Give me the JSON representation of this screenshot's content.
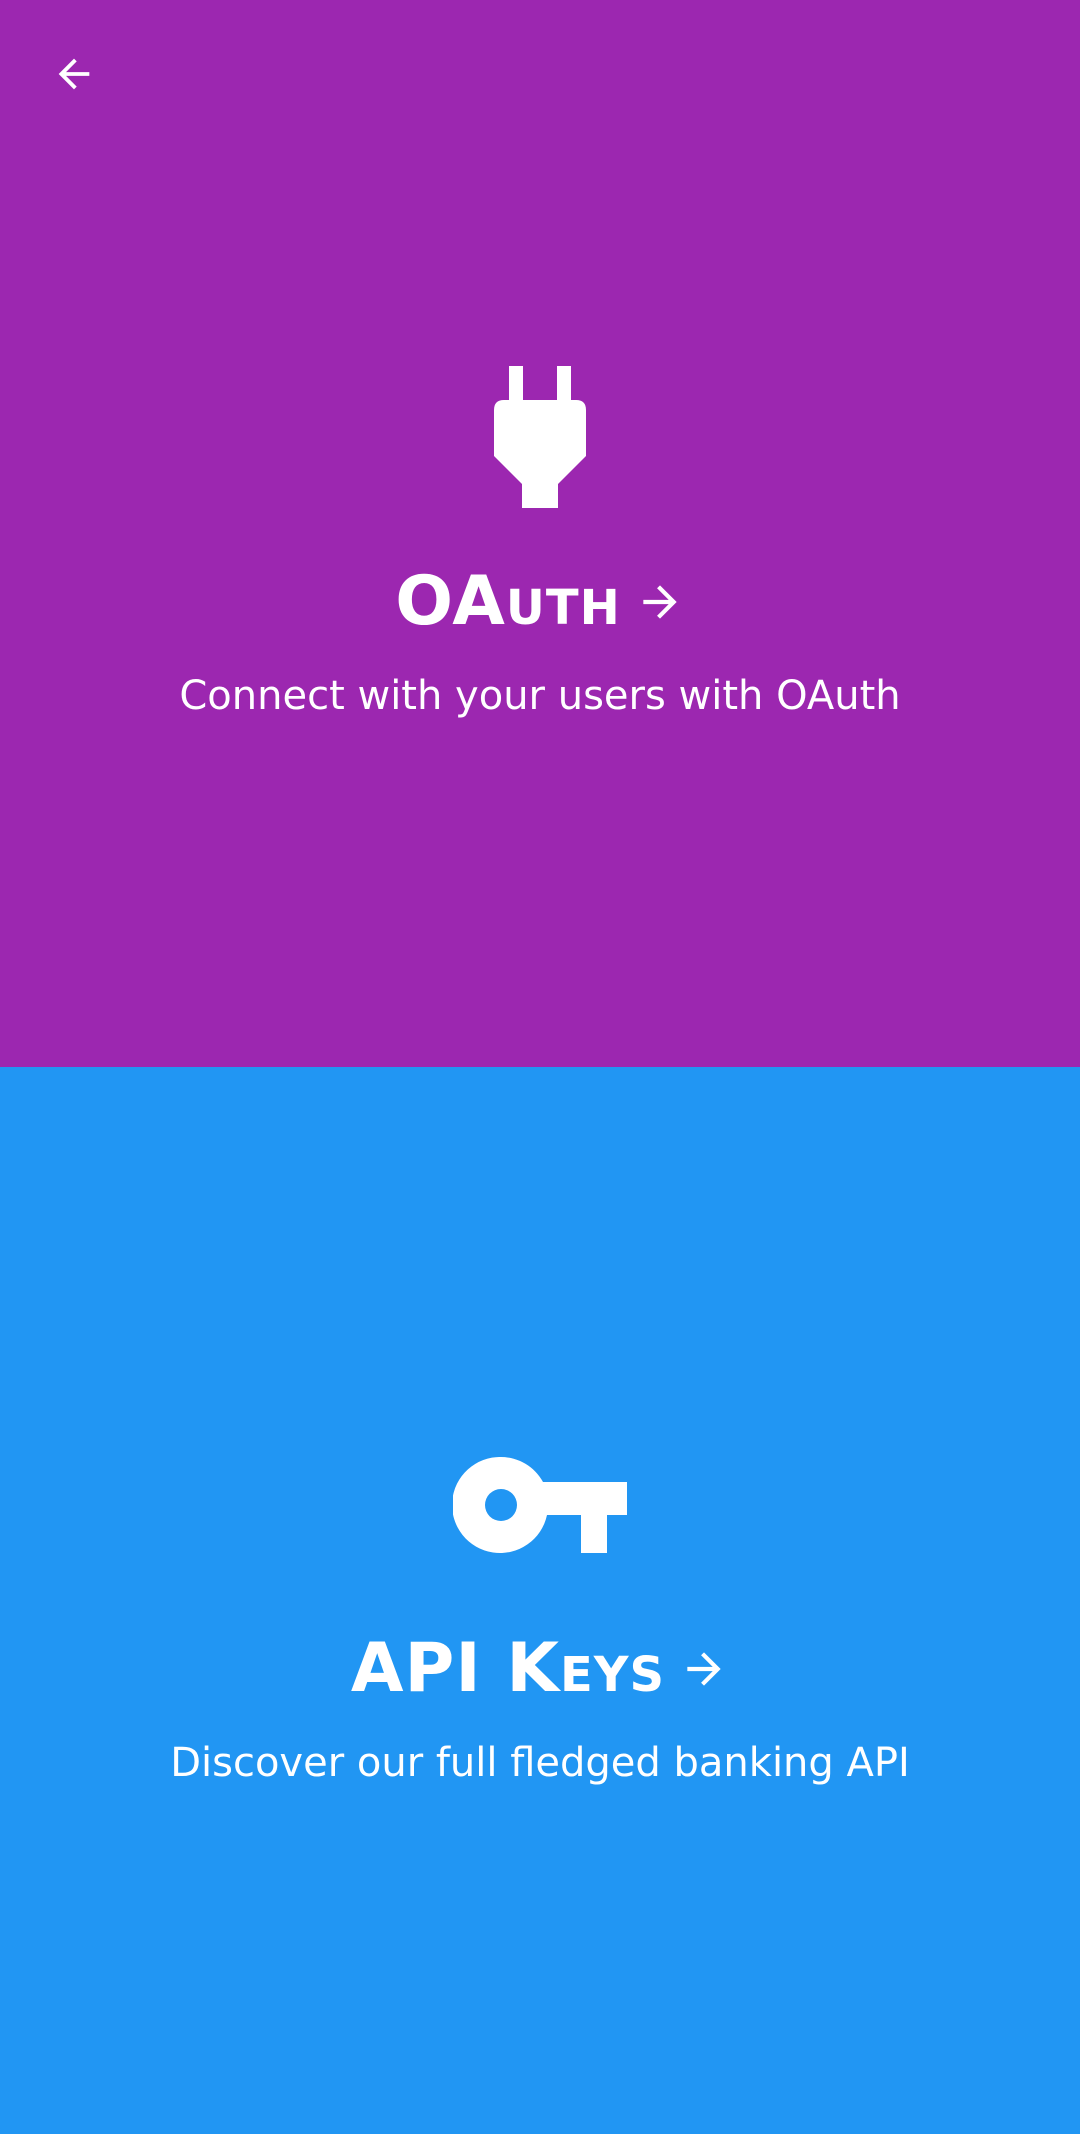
{
  "navigation": {
    "back_icon": "arrow-left-icon"
  },
  "panels": [
    {
      "id": "oauth",
      "icon": "plug-icon",
      "title": "OAuth",
      "subtitle": "Connect with your users with OAuth",
      "background": "#9C27B0"
    },
    {
      "id": "api-keys",
      "icon": "key-icon",
      "title": "API Keys",
      "subtitle": "Discover our full fledged banking API",
      "background": "#2196F3"
    }
  ],
  "colors": {
    "oauth_purple": "#9C27B0",
    "api_blue": "#2196F3",
    "foreground": "#FFFFFF"
  }
}
